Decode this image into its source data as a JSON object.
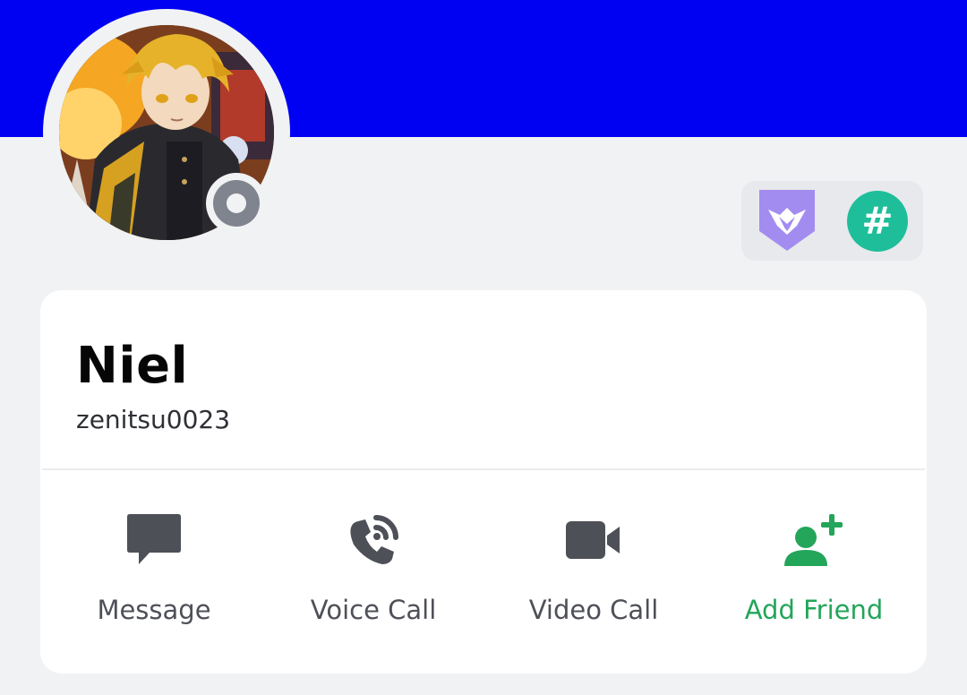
{
  "profile": {
    "display_name": "Niel",
    "username": "zenitsu0023",
    "status": "offline",
    "banner_color": "#0000f2"
  },
  "badges": [
    {
      "icon": "hypesquad-badge-icon",
      "color": "#a38cf0"
    },
    {
      "icon": "hash-badge-icon",
      "glyph": "#",
      "color": "#1fbe9a"
    }
  ],
  "actions": [
    {
      "label": "Message",
      "icon": "message-icon"
    },
    {
      "label": "Voice Call",
      "icon": "voice-call-icon"
    },
    {
      "label": "Video Call",
      "icon": "video-call-icon"
    },
    {
      "label": "Add Friend",
      "icon": "add-friend-icon",
      "color": "#23a55a"
    }
  ]
}
